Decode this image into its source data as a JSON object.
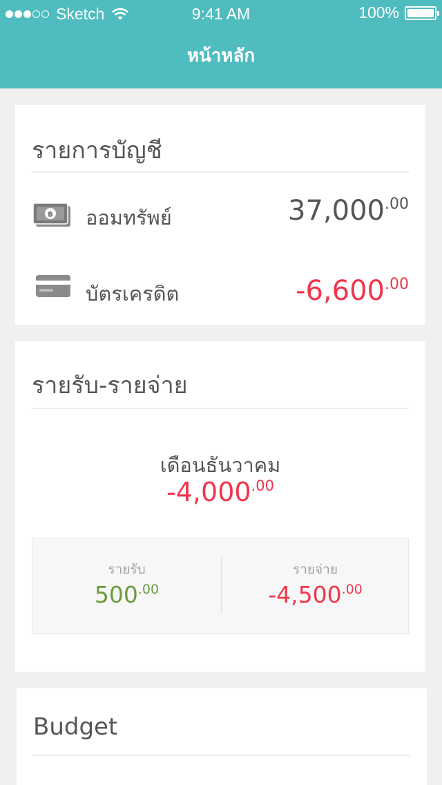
{
  "status_bar": {
    "carrier": "Sketch",
    "time": "9:41 AM",
    "battery": "100%"
  },
  "header": {
    "title": "หน้าหลัก"
  },
  "accounts": {
    "title": "รายการบัญชี",
    "items": [
      {
        "icon": "cash-icon",
        "label": "ออมทรัพย์",
        "amount": "37,000",
        "decimals": ".00",
        "color": "#555555"
      },
      {
        "icon": "credit-card-icon",
        "label": "บัตรเครดิต",
        "amount": "-6,600",
        "decimals": ".00",
        "color": "#f0364c"
      }
    ]
  },
  "income_expense": {
    "title": "รายรับ-รายจ่าย",
    "month": "เดือนธันวาคม",
    "net_amount": "-4,000",
    "net_decimals": ".00",
    "income": {
      "label": "รายรับ",
      "amount": "500",
      "decimals": ".00",
      "color": "#6a9c3c"
    },
    "expense": {
      "label": "รายจ่าย",
      "amount": "-4,500",
      "decimals": ".00",
      "color": "#f0364c"
    }
  },
  "budget": {
    "title": "Budget"
  },
  "colors": {
    "header_bg": "#4fbcc0",
    "negative": "#f0364c",
    "positive": "#6a9c3c",
    "page_bg": "#f0f0f0"
  }
}
